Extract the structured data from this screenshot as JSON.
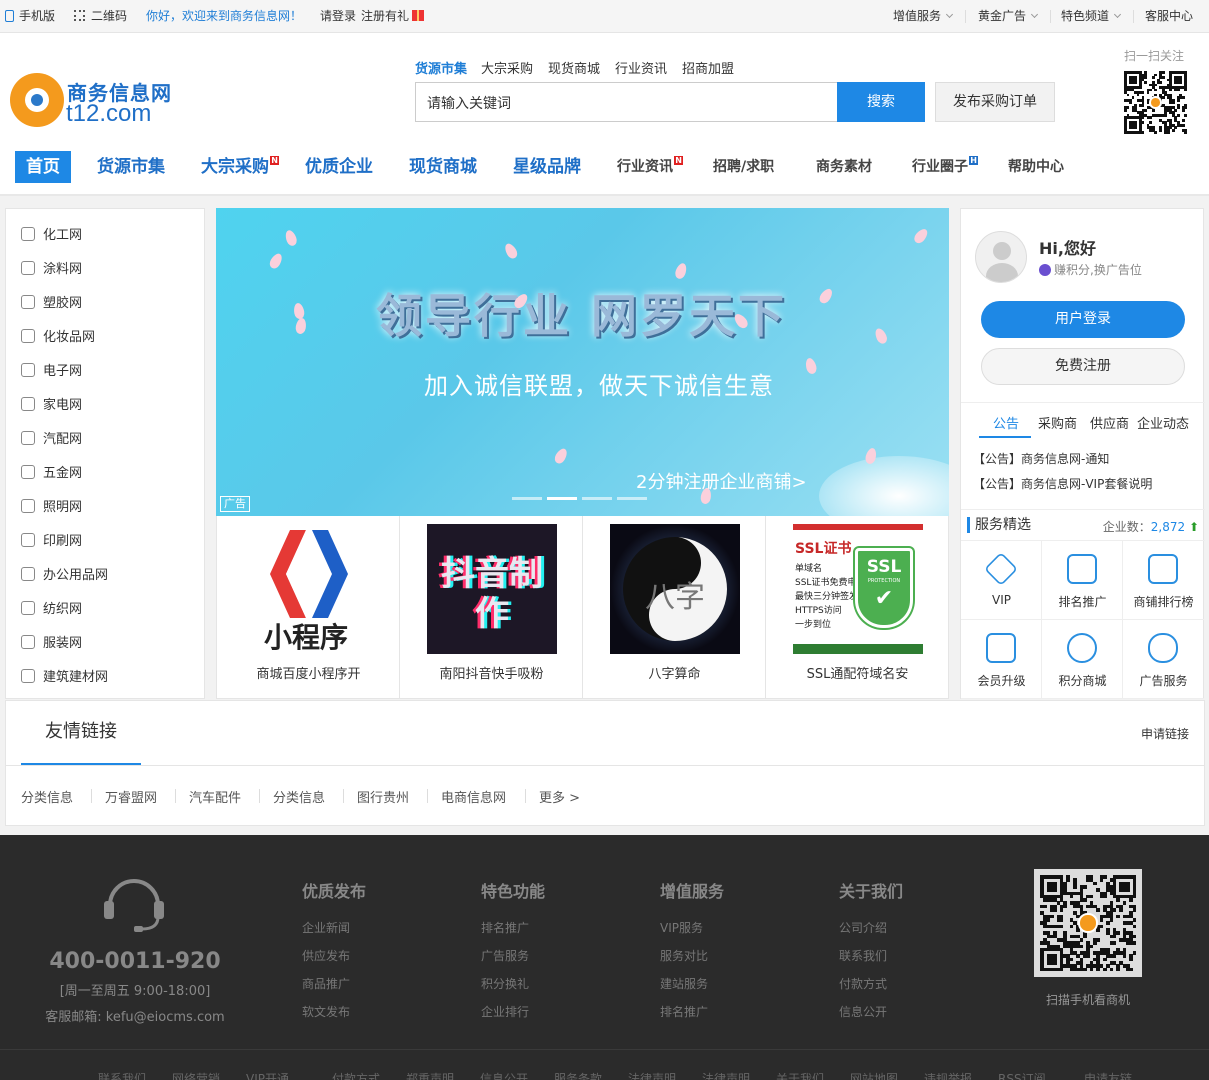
{
  "topbar": {
    "mobile": "手机版",
    "qrcode": "二维码",
    "welcome": "你好，欢迎来到商务信息网！",
    "login": "请登录",
    "register": "注册有礼",
    "value_added": "增值服务",
    "gold_ad": "黄金广告",
    "special": "特色频道",
    "service": "客服中心"
  },
  "logo": {
    "cn": "商务信息网",
    "en": "t12.com"
  },
  "search": {
    "tabs": [
      "货源市集",
      "大宗采购",
      "现货商城",
      "行业资讯",
      "招商加盟"
    ],
    "placeholder": "请输入关键词",
    "button": "搜索",
    "publish": "发布采购订单"
  },
  "qr_label": "扫一扫关注",
  "nav": {
    "home": "首页",
    "items": [
      "货源市集",
      "大宗采购",
      "优质企业",
      "现货商城",
      "星级品牌",
      "行业资讯",
      "招聘/求职",
      "商务素材",
      "行业圈子",
      "帮助中心"
    ],
    "badge_n": "N",
    "badge_h": "H"
  },
  "categories": [
    "化工网",
    "涂料网",
    "塑胶网",
    "化妆品网",
    "电子网",
    "家电网",
    "汽配网",
    "五金网",
    "照明网",
    "印刷网",
    "办公用品网",
    "纺织网",
    "服装网",
    "建筑建材网"
  ],
  "banner": {
    "title": "领导行业 网罗天下",
    "subtitle": "加入诚信联盟，做天下诚信生意",
    "cta": "2分钟注册企业商铺>",
    "ad": "广告"
  },
  "products": [
    {
      "name": "商城百度小程序开",
      "img_text": "小程序"
    },
    {
      "name": "南阳抖音快手吸粉",
      "img_text": "抖音制作"
    },
    {
      "name": "八字算命",
      "img_text": "八字"
    },
    {
      "name": "SSL通配符域名安",
      "img_text": "SSL证书"
    }
  ],
  "product_details": {
    "ssl_lines": [
      "单域名",
      "SSL证书免费申请",
      "最快三分钟签发",
      "HTTPS访问",
      "一步到位"
    ],
    "ssl_badge": "SSL",
    "ssl_badge_sub": "PROTECTION"
  },
  "user": {
    "greeting": "Hi,您好",
    "earn": "赚积分,换广告位",
    "login": "用户登录",
    "register": "免费注册"
  },
  "panel_tabs": [
    "公告",
    "采购商",
    "供应商",
    "企业动态"
  ],
  "notices": [
    "【公告】商务信息网-通知",
    "【公告】商务信息网-VIP套餐说明"
  ],
  "services": {
    "title": "服务精选",
    "count_label": "企业数：",
    "count": "2,872",
    "items": [
      "VIP",
      "排名推广",
      "商铺排行榜",
      "会员升级",
      "积分商城",
      "广告服务"
    ]
  },
  "links": {
    "title": "友情链接",
    "apply": "申请链接",
    "items": [
      "分类信息",
      "万睿盟网",
      "汽车配件",
      "分类信息",
      "图行贵州",
      "电商信息网",
      "更多 >"
    ]
  },
  "footer": {
    "phone": "400-0011-920",
    "hours": "[周一至周五 9:00-18:00]",
    "email": "客服邮箱: kefu@eiocms.com",
    "columns": [
      {
        "title": "优质发布",
        "items": [
          "企业新闻",
          "供应发布",
          "商品推广",
          "软文发布"
        ]
      },
      {
        "title": "特色功能",
        "items": [
          "排名推广",
          "广告服务",
          "积分换礼",
          "企业排行"
        ]
      },
      {
        "title": "增值服务",
        "items": [
          "VIP服务",
          "服务对比",
          "建站服务",
          "排名推广"
        ]
      },
      {
        "title": "关于我们",
        "items": [
          "公司介绍",
          "联系我们",
          "付款方式",
          "信息公开"
        ]
      }
    ],
    "qr_label": "扫描手机看商机",
    "bottom_links": [
      "联系我们",
      "网络营销",
      "VIP开通",
      "付款方式",
      "郑重声明",
      "信息公开",
      "服务条款",
      "法律声明",
      "法律声明",
      "关于我们",
      "网站地图",
      "违规举报",
      "RSS订阅",
      "申请友链"
    ]
  },
  "colors": {
    "accent": "#1e88e5",
    "brand_orange": "#f49a1d",
    "footer_bg": "#2b2b2b"
  }
}
